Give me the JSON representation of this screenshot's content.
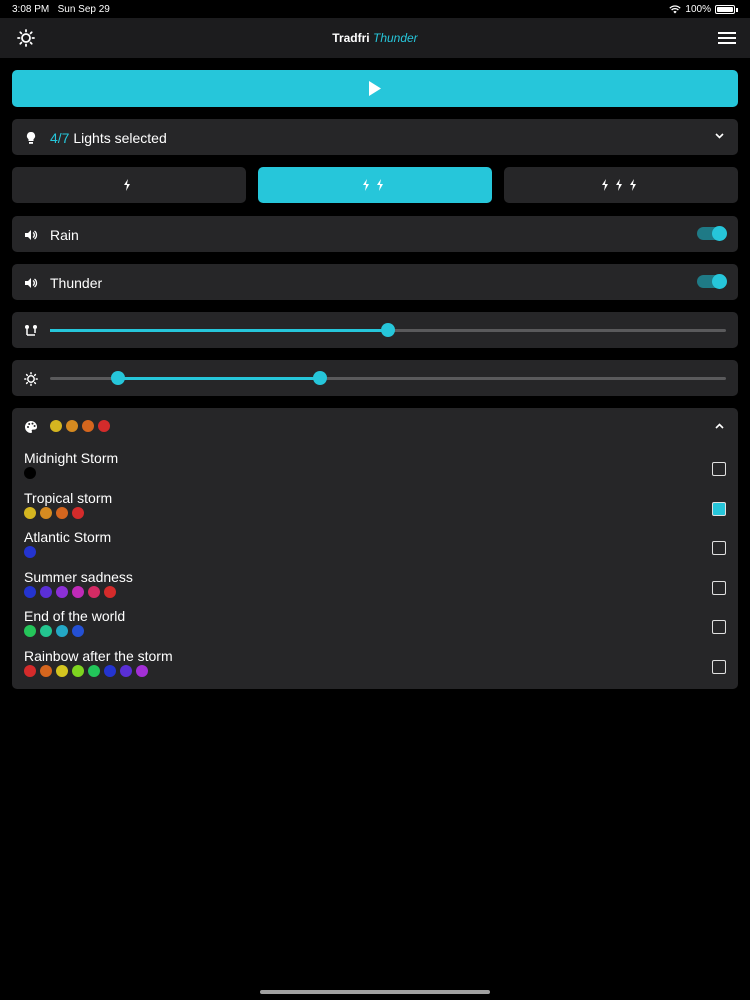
{
  "status": {
    "time": "3:08 PM",
    "date": "Sun Sep 29",
    "battery": "100%"
  },
  "nav": {
    "title": "Tradfri",
    "title_accent": "Thunder"
  },
  "lights": {
    "count": "4/7",
    "label": "Lights selected"
  },
  "intensity": {
    "options": [
      "1",
      "2",
      "3"
    ],
    "selected": 1
  },
  "sounds": [
    {
      "label": "Rain",
      "enabled": true
    },
    {
      "label": "Thunder",
      "enabled": true
    }
  ],
  "frequency_slider": {
    "value": 0.5
  },
  "brightness_slider": {
    "low": 0.1,
    "high": 0.4
  },
  "palette_header": {
    "colors": [
      "#d4b520",
      "#d58a20",
      "#d5661e",
      "#d42b2b"
    ]
  },
  "palettes": [
    {
      "name": "Midnight Storm",
      "colors": [
        "#000000"
      ],
      "checked": false
    },
    {
      "name": "Tropical storm",
      "colors": [
        "#d4b520",
        "#d58a20",
        "#d5661e",
        "#d42b2b"
      ],
      "checked": true
    },
    {
      "name": "Atlantic Storm",
      "colors": [
        "#2434d0"
      ],
      "checked": false
    },
    {
      "name": "Summer sadness",
      "colors": [
        "#2434d0",
        "#5a2fd6",
        "#8c30d6",
        "#c02ab8",
        "#d42b64",
        "#d42b2b"
      ],
      "checked": false
    },
    {
      "name": "End of the world",
      "colors": [
        "#25c55a",
        "#23c48f",
        "#24a8c6",
        "#2450d4"
      ],
      "checked": false
    },
    {
      "name": "Rainbow after the storm",
      "colors": [
        "#d42b2b",
        "#d5661e",
        "#d4c520",
        "#7ed420",
        "#22c55a",
        "#2434d0",
        "#5a2fd6",
        "#a32fd6"
      ],
      "checked": false
    }
  ],
  "colors": {
    "accent": "#26c6da",
    "card": "#262628",
    "navbar": "#1c1c1e"
  }
}
